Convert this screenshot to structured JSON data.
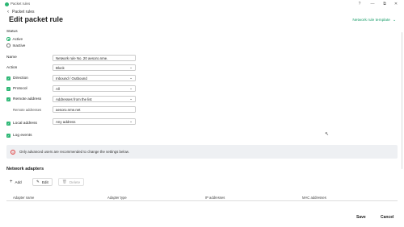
{
  "window": {
    "app_title": "Packet rules",
    "help_icon": "?",
    "minimize_icon": "—",
    "restore_icon": "⧉",
    "close_icon": "✕"
  },
  "header": {
    "back_label": "Packet rules",
    "title": "Edit packet rule",
    "template_label": "Network rule template"
  },
  "status": {
    "label": "Status",
    "options": [
      "Active",
      "Inactive"
    ],
    "selected": "Active"
  },
  "form": {
    "name_label": "Name",
    "name_value": "Network rule No. 20 aesoro.nme.",
    "action_label": "Action",
    "action_value": "Block",
    "direction_label": "Direction",
    "direction_value": "Inbound / Outbound",
    "protocol_label": "Protocol",
    "protocol_value": "All",
    "remote_label": "Remote address",
    "remote_value": "Addresses from the list",
    "remote_addresses_label": "Remote addresses",
    "remote_addresses_value": "aesoro.nme.net",
    "local_label": "Local address",
    "local_value": "Any address",
    "log_label": "Log events"
  },
  "info": {
    "text": "Only advanced users are recommended to change the settings below."
  },
  "adapters": {
    "title": "Network adapters",
    "add_label": "Add",
    "edit_label": "Edit",
    "delete_label": "Delete",
    "columns": [
      "Adapter name",
      "Adapter type",
      "IP addresses",
      "MAC addresses"
    ]
  },
  "footer": {
    "save_label": "Save",
    "cancel_label": "Cancel"
  },
  "colors": {
    "accent": "#2bb673",
    "link": "#1b9e6b",
    "info_bg": "#eef0f3"
  }
}
